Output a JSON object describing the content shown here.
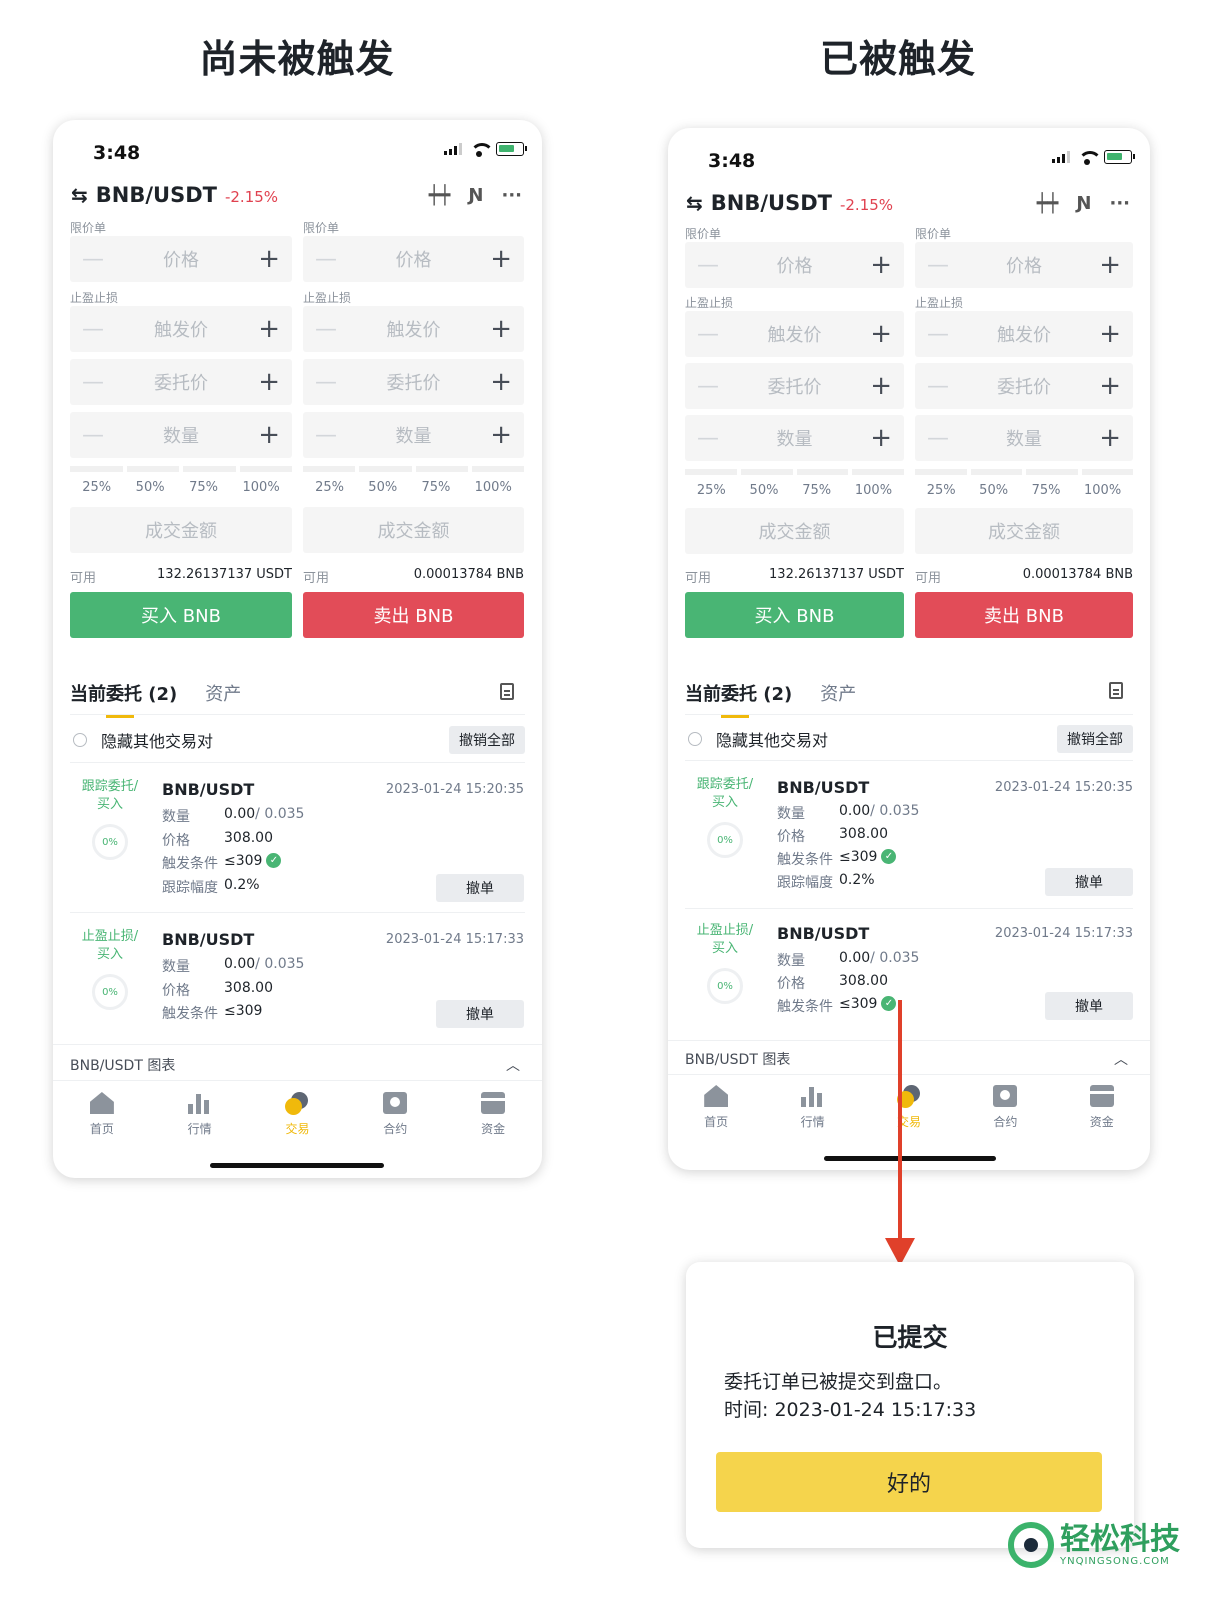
{
  "headings": {
    "left": "尚未被触发",
    "right": "已被触发"
  },
  "phone": {
    "time": "3:48",
    "pair": "BNB/USDT",
    "change": "-2.15%",
    "limit_label": "限价单",
    "tpsl_label": "止盈止损",
    "price_ph": "价格",
    "trigger_ph": "触发价",
    "order_price_ph": "委托价",
    "qty_ph": "数量",
    "pcts": [
      "25%",
      "50%",
      "75%",
      "100%"
    ],
    "amount_ph": "成交金额",
    "avail_label": "可用",
    "avail_usdt": "132.26137137 USDT",
    "avail_bnb": "0.00013784 BNB",
    "buy": "买入 BNB",
    "sell": "卖出 BNB",
    "tab_orders": "当前委托 (2)",
    "tab_assets": "资产",
    "hide_pairs": "隐藏其他交易对",
    "cancel_all": "撤销全部",
    "orders": [
      {
        "type": "跟踪委托/\n买入",
        "type_l1": "跟踪委托/",
        "type_l2": "买入",
        "pct": "0%",
        "pair": "BNB/USDT",
        "time": "2023-01-24 15:20:35",
        "qty_k": "数量",
        "qty_v": "0.00",
        "qty_total": " / 0.035",
        "price_k": "价格",
        "price_v": "308.00",
        "trig_k": "触发条件",
        "trig_v": "≤309",
        "trail_k": "跟踪幅度",
        "trail_v": "0.2%",
        "cancel": "撤单"
      },
      {
        "type_l1": "止盈止损/",
        "type_l2": "买入",
        "pct": "0%",
        "pair": "BNB/USDT",
        "time": "2023-01-24 15:17:33",
        "qty_k": "数量",
        "qty_v": "0.00",
        "qty_total": " / 0.035",
        "price_k": "价格",
        "price_v": "308.00",
        "trig_k": "触发条件",
        "trig_v": "≤309",
        "cancel": "撤单"
      }
    ],
    "chart_bar": "BNB/USDT 图表",
    "nav": [
      "首页",
      "行情",
      "交易",
      "合约",
      "资金"
    ]
  },
  "dialog": {
    "title": "已提交",
    "line1": "委托订单已被提交到盘口。",
    "line2": "时间: 2023-01-24 15:17:33",
    "ok": "好的"
  },
  "watermark": {
    "name": "轻松科技",
    "domain": "YNQINGSONG.COM"
  },
  "colors": {
    "buy": "#49b574",
    "sell": "#e24c58",
    "accent": "#f0b90b",
    "arrow": "#e0402a",
    "dialog_button": "#f5d44c"
  }
}
